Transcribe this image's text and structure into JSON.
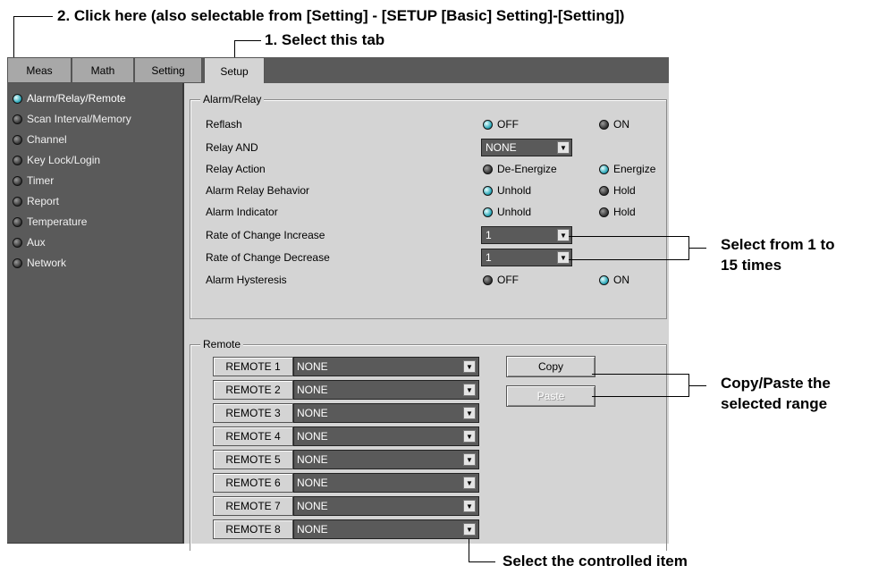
{
  "callouts": {
    "step2": "2. Click here (also selectable from [Setting] - [SETUP [Basic] Setting]-[Setting])",
    "step1": "1. Select this tab",
    "select_range_1": "Select from 1 to",
    "select_range_2": "15 times",
    "copy_paste_1": "Copy/Paste the",
    "copy_paste_2": "selected range",
    "select_item": "Select the controlled item"
  },
  "tabs": [
    "Meas",
    "Math",
    "Setting",
    "Setup"
  ],
  "sidebar": {
    "items": [
      "Alarm/Relay/Remote",
      "Scan Interval/Memory",
      "Channel",
      "Key Lock/Login",
      "Timer",
      "Report",
      "Temperature",
      "Aux",
      "Network"
    ]
  },
  "alarm_relay": {
    "title": "Alarm/Relay",
    "reflash": {
      "label": "Reflash",
      "opt1": "OFF",
      "opt2": "ON",
      "selected": "OFF"
    },
    "relay_and": {
      "label": "Relay AND",
      "value": "NONE"
    },
    "relay_action": {
      "label": "Relay Action",
      "opt1": "De-Energize",
      "opt2": "Energize",
      "selected": "Energize"
    },
    "alarm_relay_behavior": {
      "label": "Alarm Relay Behavior",
      "opt1": "Unhold",
      "opt2": "Hold",
      "selected": "Unhold"
    },
    "alarm_indicator": {
      "label": "Alarm Indicator",
      "opt1": "Unhold",
      "opt2": "Hold",
      "selected": "Unhold"
    },
    "rate_increase": {
      "label": "Rate of Change Increase",
      "value": "1"
    },
    "rate_decrease": {
      "label": "Rate of Change Decrease",
      "value": "1"
    },
    "alarm_hysteresis": {
      "label": "Alarm Hysteresis",
      "opt1": "OFF",
      "opt2": "ON",
      "selected": "ON"
    }
  },
  "remote": {
    "title": "Remote",
    "rows": [
      {
        "label": "REMOTE 1",
        "value": "NONE"
      },
      {
        "label": "REMOTE 2",
        "value": "NONE"
      },
      {
        "label": "REMOTE 3",
        "value": "NONE"
      },
      {
        "label": "REMOTE 4",
        "value": "NONE"
      },
      {
        "label": "REMOTE 5",
        "value": "NONE"
      },
      {
        "label": "REMOTE 6",
        "value": "NONE"
      },
      {
        "label": "REMOTE 7",
        "value": "NONE"
      },
      {
        "label": "REMOTE 8",
        "value": "NONE"
      }
    ],
    "copy_label": "Copy",
    "paste_label": "Paste"
  }
}
